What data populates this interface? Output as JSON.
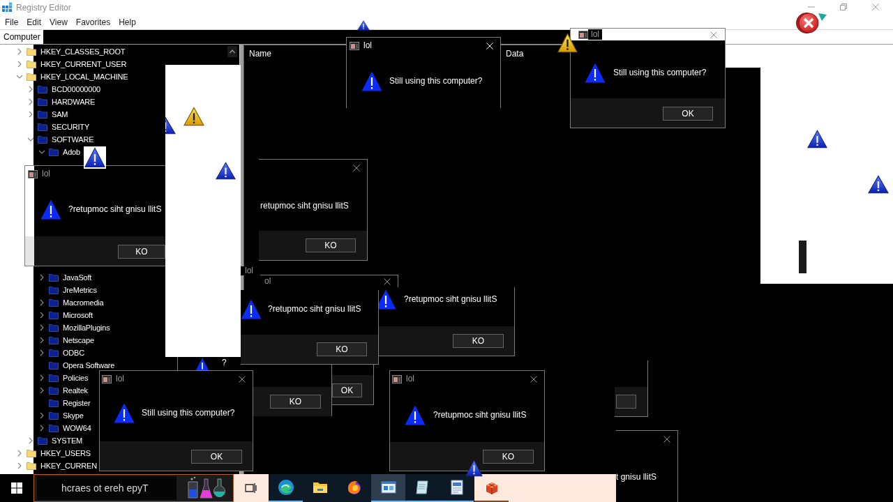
{
  "window": {
    "title": "Registry Editor",
    "menu": [
      "File",
      "Edit",
      "View",
      "Favorites",
      "Help"
    ],
    "address": "Computer"
  },
  "tree": [
    {
      "label": "HKEY_CLASSES_ROOT",
      "kind": "key",
      "expanded": false
    },
    {
      "label": "HKEY_CURRENT_USER",
      "kind": "key",
      "expanded": false
    },
    {
      "label": "HKEY_LOCAL_MACHINE",
      "kind": "key",
      "expanded": true,
      "children": [
        {
          "label": "BCD00000000",
          "kind": "key",
          "expanded": false
        },
        {
          "label": "HARDWARE",
          "kind": "key",
          "expanded": false
        },
        {
          "label": "SAM",
          "kind": "key",
          "expanded": false
        },
        {
          "label": "SECURITY",
          "kind": "leaf"
        },
        {
          "label": "SOFTWARE",
          "kind": "key",
          "expanded": true,
          "children": [
            {
              "label": "Adob",
              "kind": "key",
              "expanded": true
            },
            {
              "label": "JavaSoft",
              "kind": "key",
              "expanded": false
            },
            {
              "label": "JreMetrics",
              "kind": "leaf"
            },
            {
              "label": "Macromedia",
              "kind": "key",
              "expanded": false
            },
            {
              "label": "Microsoft",
              "kind": "key",
              "expanded": false
            },
            {
              "label": "MozillaPlugins",
              "kind": "key",
              "expanded": false
            },
            {
              "label": "Netscape",
              "kind": "key",
              "expanded": false
            },
            {
              "label": "ODBC",
              "kind": "key",
              "expanded": false
            },
            {
              "label": "Opera Software",
              "kind": "leaf"
            },
            {
              "label": "Policies",
              "kind": "key",
              "expanded": false
            },
            {
              "label": "Realtek",
              "kind": "key",
              "expanded": false
            },
            {
              "label": "Register",
              "kind": "leaf"
            },
            {
              "label": "Skype",
              "kind": "key",
              "expanded": false
            },
            {
              "label": "WOW64",
              "kind": "key",
              "expanded": false
            }
          ]
        },
        {
          "label": "SYSTEM",
          "kind": "key",
          "expanded": false
        }
      ]
    },
    {
      "label": "HKEY_USERS",
      "kind": "key",
      "expanded": false
    },
    {
      "label": "HKEY_CURREN",
      "kind": "key",
      "expanded": false
    }
  ],
  "list": {
    "columns": [
      "Name",
      "Data"
    ]
  },
  "dialogs": [
    {
      "title": "lol",
      "message": "Still using this computer?",
      "active": true
    },
    {
      "title": "lol",
      "message": "Still using this computer?",
      "button": "OK",
      "active": false
    },
    {
      "title": "lol",
      "message": "?retupmoc siht gnisu llitS",
      "button": "KO",
      "active": false
    },
    {
      "message": "retupmoc siht gnisu llitS",
      "button": "KO",
      "active": false
    },
    {
      "title": "lol",
      "active": false
    },
    {
      "title": "ol",
      "active": false
    },
    {
      "message": "?",
      "button": "KO"
    },
    {
      "message": "?retupmoc siht gnisu llitS",
      "button": "KO"
    },
    {
      "message": "?retupmoc siht gnisu llitS",
      "button": "KO"
    },
    {
      "button": "OK"
    },
    {
      "title": "lol",
      "message": "Still using this computer?",
      "button": "OK",
      "active": false
    },
    {
      "title": "lol",
      "message": "?retupmoc siht gnisu llitS",
      "button": "KO",
      "active": false
    },
    {
      "message": "t gnisu llitS",
      "active": false
    }
  ],
  "taskbar": {
    "search": {
      "placeholder": "hcraes ot ereh epyT"
    },
    "apps": [
      {
        "kind": "swirl",
        "selected": false,
        "running": true
      },
      {
        "kind": "folder",
        "selected": false,
        "running": false
      },
      {
        "kind": "flame-globe",
        "selected": false,
        "running": false
      },
      {
        "kind": "window",
        "selected": true,
        "running": true
      },
      {
        "kind": "notepad",
        "selected": false,
        "running": true
      },
      {
        "kind": "document",
        "selected": false,
        "running": true
      },
      {
        "kind": "cube",
        "selected": false,
        "running": true
      }
    ]
  }
}
